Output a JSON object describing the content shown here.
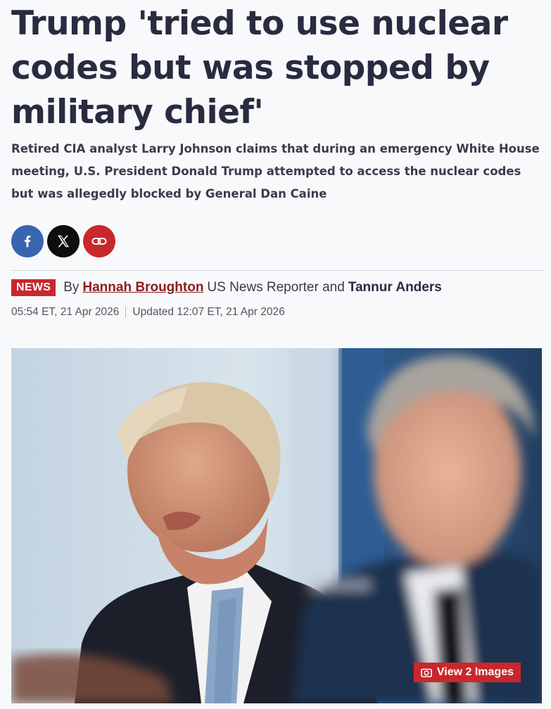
{
  "article": {
    "headline": "Trump 'tried to use nuclear codes but was stopped by military chief'",
    "standfirst": "Retired CIA analyst Larry Johnson claims that during an emergency White House meeting, U.S. President Donald Trump attempted to access the nuclear codes but was allegedly blocked by General Dan Caine"
  },
  "share": {
    "facebook_icon": "facebook-icon",
    "x_icon": "x-icon",
    "link_icon": "link-icon",
    "colors": {
      "facebook": "#3765b0",
      "x": "#0e0e0e",
      "link": "#c8282c"
    }
  },
  "byline": {
    "badge": "NEWS",
    "by": "By",
    "author1": "Hannah Broughton",
    "role": "US News Reporter and",
    "author2": "Tannur Anders"
  },
  "dates": {
    "published": "05:54 ET, 21 Apr 2026",
    "updated": "Updated 12:07 ET, 21 Apr 2026"
  },
  "image": {
    "gallery_button": "View 2 Images",
    "gallery_icon": "camera-icon"
  },
  "colors": {
    "accent": "#c8282c",
    "headline": "#2a2a41"
  }
}
